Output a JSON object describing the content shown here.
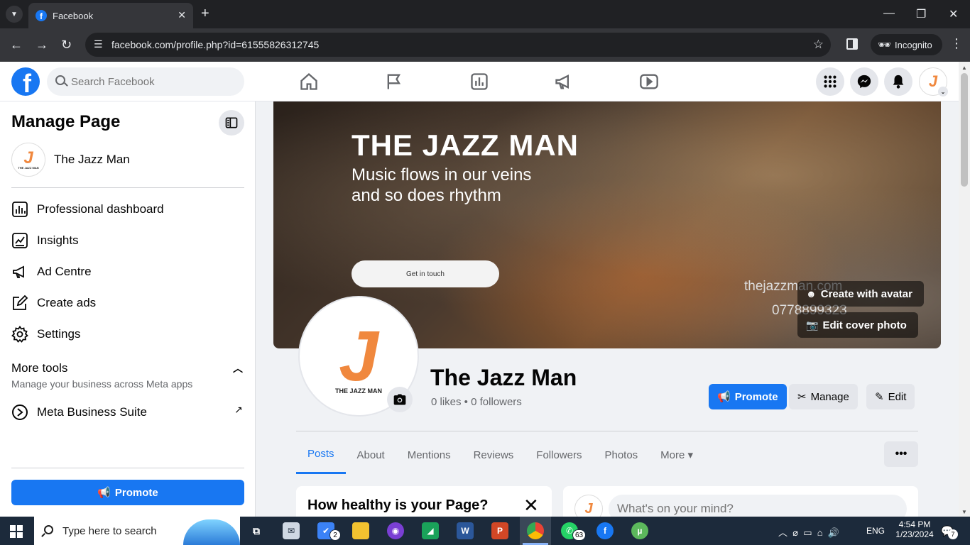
{
  "browser": {
    "tab_title": "Facebook",
    "url": "facebook.com/profile.php?id=61555826312745",
    "incognito_label": "Incognito"
  },
  "fb_nav": {
    "search_placeholder": "Search Facebook",
    "icons": [
      "home-icon",
      "flag-icon",
      "insights-icon",
      "megaphone-icon",
      "video-icon",
      "apps-grid-icon",
      "messenger-icon",
      "bell-icon"
    ]
  },
  "left_panel": {
    "title": "Manage Page",
    "page_name": "The Jazz Man",
    "menu": [
      {
        "label": "Professional dashboard",
        "icon": "dashboard-icon"
      },
      {
        "label": "Insights",
        "icon": "insights-icon"
      },
      {
        "label": "Ad Centre",
        "icon": "megaphone-icon"
      },
      {
        "label": "Create ads",
        "icon": "pencil-square-icon"
      },
      {
        "label": "Settings",
        "icon": "gear-icon"
      }
    ],
    "more_tools_title": "More tools",
    "more_tools_subtitle": "Manage your business across Meta apps",
    "meta_business_suite": "Meta Business Suite",
    "promote_label": "Promote"
  },
  "cover": {
    "title": "THE JAZZ MAN",
    "tagline_1": "Music flows in our veins",
    "tagline_2": "and so does rhythm",
    "cta": "Get in touch",
    "website": "thejazzman.com",
    "phone": "0778899323",
    "avatar_button": "Create with avatar",
    "edit_cover_button": "Edit cover photo"
  },
  "profile": {
    "logo_letter": "J",
    "logo_text": "THE JAZZ MAN",
    "name": "The Jazz Man",
    "stats": "0 likes • 0 followers",
    "actions": {
      "promote": "Promote",
      "manage": "Manage",
      "edit": "Edit"
    }
  },
  "tabs": [
    {
      "label": "Posts",
      "active": true
    },
    {
      "label": "About"
    },
    {
      "label": "Mentions"
    },
    {
      "label": "Reviews"
    },
    {
      "label": "Followers"
    },
    {
      "label": "Photos"
    },
    {
      "label": "More ▾"
    }
  ],
  "health_card": {
    "title": "How healthy is your Page?"
  },
  "composer": {
    "placeholder": "What's on your mind?"
  },
  "taskbar": {
    "search_placeholder": "Type here to search",
    "todo_badge": "2",
    "whatsapp_badge": "63",
    "language": "ENG",
    "time": "4:54 PM",
    "date": "1/23/2024",
    "notification_badge": "7"
  }
}
